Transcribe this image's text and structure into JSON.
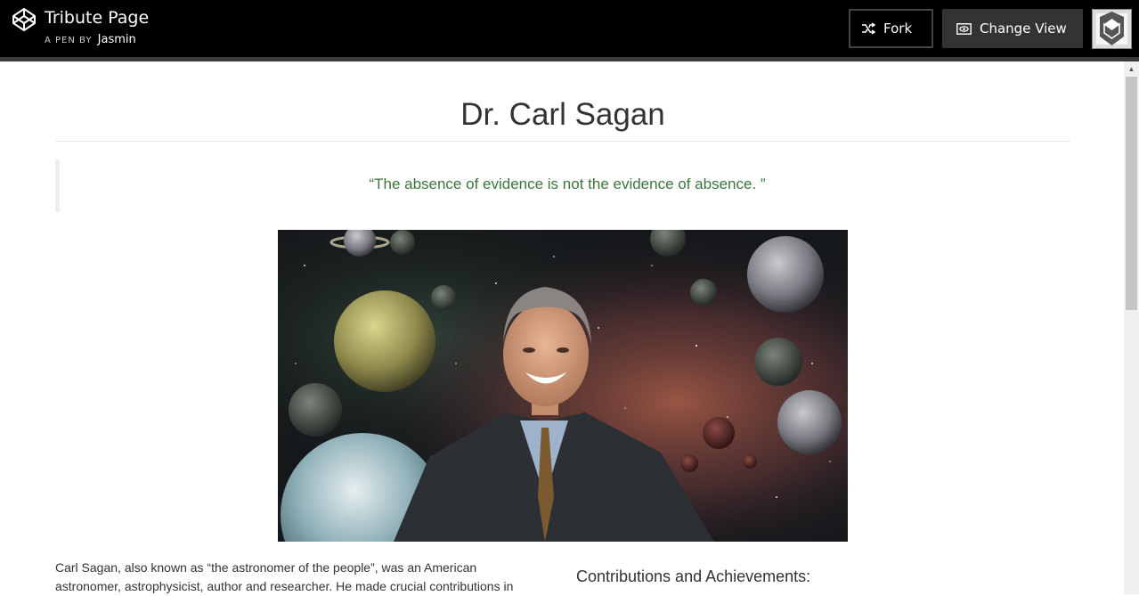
{
  "header": {
    "title": "Tribute Page",
    "byline_prefix": "A PEN BY",
    "author": "Jasmin",
    "fork_label": "Fork",
    "change_view_label": "Change View"
  },
  "page": {
    "heading": "Dr. Carl Sagan",
    "quote": "“The absence of evidence is not the evidence of absence. ”",
    "image_alt": "Carl Sagan smiling in front of planets and a nebula",
    "bio": "Carl Sagan, also known as “the astronomer of the people”, was an American astronomer, astrophysicist, author and researcher. He made crucial contributions in",
    "contributions_heading": "Contributions and Achievements:"
  },
  "colors": {
    "topbar_bg": "#000000",
    "quote_text": "#3c763d",
    "heading_text": "#333333"
  },
  "icons": [
    "codepen-logo-icon",
    "fork-icon",
    "eye-icon",
    "user-avatar-icon"
  ]
}
